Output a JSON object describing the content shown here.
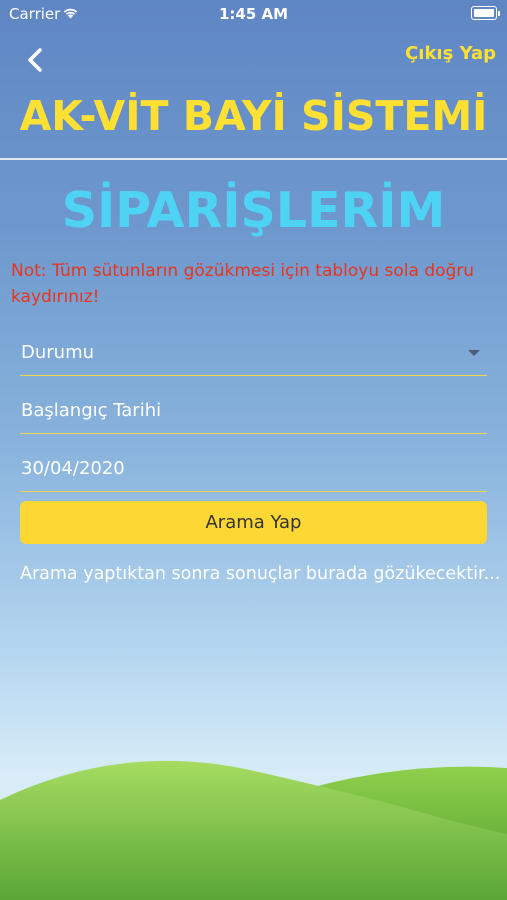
{
  "status_bar": {
    "carrier": "Carrier",
    "time": "1:45 AM",
    "wifi_icon": "wifi-icon",
    "battery_icon": "battery-icon"
  },
  "nav": {
    "back_icon": "chevron-left-icon",
    "logout_label": "Çıkış Yap"
  },
  "header": {
    "app_title": "AK-VİT BAYİ SİSTEMİ"
  },
  "page": {
    "title": "SİPARİŞLERİM",
    "note": "Not: Tüm sütunların gözükmesi için tabloyu sola doğru kaydırınız!"
  },
  "form": {
    "status_field": {
      "value": "Durumu",
      "icon": "chevron-down-icon"
    },
    "start_date_field": {
      "value": "Başlangıç Tarihi"
    },
    "date_field": {
      "value": "30/04/2020"
    },
    "search_button_label": "Arama Yap"
  },
  "results": {
    "message": "Arama yaptıktan sonra sonuçlar burada gözükecektir..."
  },
  "colors": {
    "accent_yellow": "#fdd835",
    "title_yellow": "#ffe033",
    "title_cyan": "#4fd3f5",
    "note_red": "#e8341c",
    "grass_green": "#6cb03a"
  }
}
